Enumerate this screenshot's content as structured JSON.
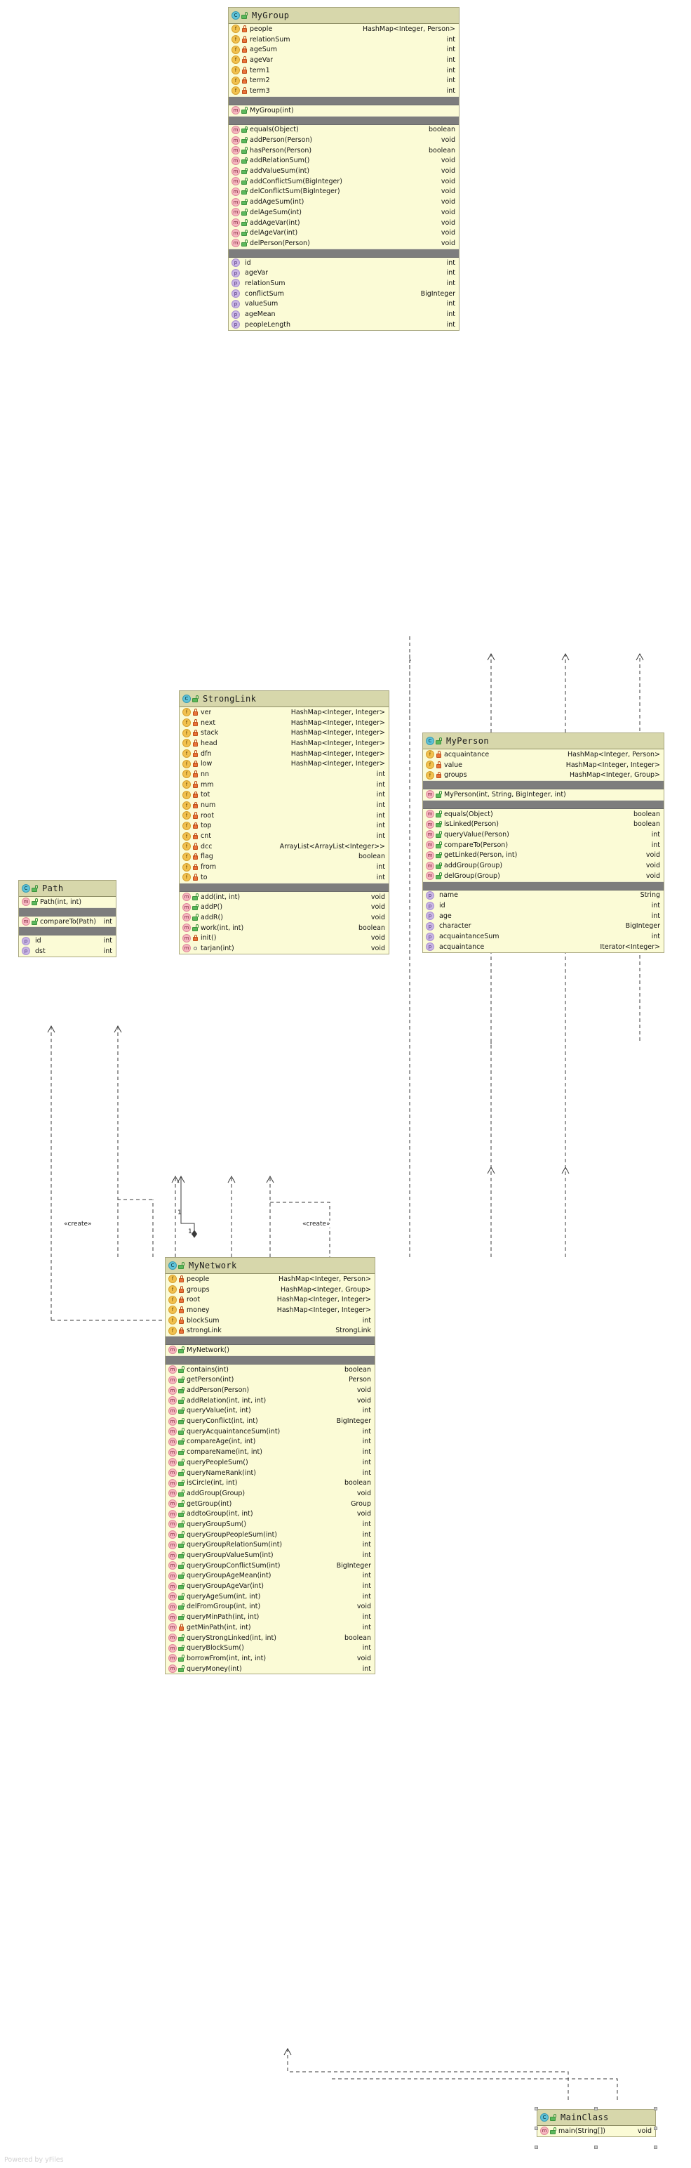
{
  "diagram": {
    "watermark": "Powered by yFiles",
    "edge_labels": [
      "«create»",
      "«create»"
    ],
    "multiplicity_labels": [
      "1",
      "1"
    ],
    "colors": {
      "class_body": "#fbfbd6",
      "class_header": "#d7d7ab",
      "class_border": "#a9a780",
      "separator": "#7d7d7d",
      "field_icon": "#f2c14e",
      "method_icon": "#f6b7c0",
      "property_icon": "#c9b6e4",
      "class_icon": "#5fc2d8",
      "private_lock": "#e8743b",
      "public_lock": "#5cb85c"
    }
  },
  "classes": {
    "mygroup": {
      "name": "MyGroup",
      "fields": [
        {
          "name": "people",
          "type": "HashMap<Integer, Person>",
          "vis": "private",
          "inline": true
        },
        {
          "name": "relationSum",
          "type": "int",
          "vis": "private"
        },
        {
          "name": "ageSum",
          "type": "int",
          "vis": "private"
        },
        {
          "name": "ageVar",
          "type": "int",
          "vis": "private"
        },
        {
          "name": "term1",
          "type": "int",
          "vis": "private"
        },
        {
          "name": "term2",
          "type": "int",
          "vis": "private"
        },
        {
          "name": "term3",
          "type": "int",
          "vis": "private"
        }
      ],
      "constructors": [
        {
          "name": "MyGroup(int)",
          "type": "",
          "vis": "public"
        }
      ],
      "methods": [
        {
          "name": "equals(Object)",
          "type": "boolean",
          "vis": "public"
        },
        {
          "name": "addPerson(Person)",
          "type": "void",
          "vis": "public"
        },
        {
          "name": "hasPerson(Person)",
          "type": "boolean",
          "vis": "public"
        },
        {
          "name": "addRelationSum()",
          "type": "void",
          "vis": "public"
        },
        {
          "name": "addValueSum(int)",
          "type": "void",
          "vis": "public"
        },
        {
          "name": "addConflictSum(BigInteger)",
          "type": "void",
          "vis": "public"
        },
        {
          "name": "delConflictSum(BigInteger)",
          "type": "void",
          "vis": "public"
        },
        {
          "name": "addAgeSum(int)",
          "type": "void",
          "vis": "public"
        },
        {
          "name": "delAgeSum(int)",
          "type": "void",
          "vis": "public"
        },
        {
          "name": "addAgeVar(int)",
          "type": "void",
          "vis": "public"
        },
        {
          "name": "delAgeVar(int)",
          "type": "void",
          "vis": "public"
        },
        {
          "name": "delPerson(Person)",
          "type": "void",
          "vis": "public"
        }
      ],
      "properties": [
        {
          "name": "id",
          "type": "int"
        },
        {
          "name": "ageVar",
          "type": "int"
        },
        {
          "name": "relationSum",
          "type": "int"
        },
        {
          "name": "conflictSum",
          "type": "BigInteger"
        },
        {
          "name": "valueSum",
          "type": "int"
        },
        {
          "name": "ageMean",
          "type": "int"
        },
        {
          "name": "peopleLength",
          "type": "int"
        }
      ]
    },
    "stronglink": {
      "name": "StrongLink",
      "fields": [
        {
          "name": "ver",
          "type": "HashMap<Integer, Integer>",
          "vis": "private"
        },
        {
          "name": "next",
          "type": "HashMap<Integer, Integer>",
          "vis": "private"
        },
        {
          "name": "stack",
          "type": "HashMap<Integer, Integer>",
          "vis": "private"
        },
        {
          "name": "head",
          "type": "HashMap<Integer, Integer>",
          "vis": "private"
        },
        {
          "name": "dfn",
          "type": "HashMap<Integer, Integer>",
          "vis": "private"
        },
        {
          "name": "low",
          "type": "HashMap<Integer, Integer>",
          "vis": "private"
        },
        {
          "name": "nn",
          "type": "int",
          "vis": "private"
        },
        {
          "name": "mm",
          "type": "int",
          "vis": "private"
        },
        {
          "name": "tot",
          "type": "int",
          "vis": "private"
        },
        {
          "name": "num",
          "type": "int",
          "vis": "private"
        },
        {
          "name": "root",
          "type": "int",
          "vis": "private"
        },
        {
          "name": "top",
          "type": "int",
          "vis": "private"
        },
        {
          "name": "cnt",
          "type": "int",
          "vis": "private"
        },
        {
          "name": "dcc",
          "type": "ArrayList<ArrayList<Integer>>",
          "vis": "private",
          "inline": true
        },
        {
          "name": "flag",
          "type": "boolean",
          "vis": "private"
        },
        {
          "name": "from",
          "type": "int",
          "vis": "private"
        },
        {
          "name": "to",
          "type": "int",
          "vis": "private"
        }
      ],
      "constructors": [],
      "methods": [
        {
          "name": "add(int, int)",
          "type": "void",
          "vis": "public"
        },
        {
          "name": "addP()",
          "type": "void",
          "vis": "public"
        },
        {
          "name": "addR()",
          "type": "void",
          "vis": "public"
        },
        {
          "name": "work(int, int)",
          "type": "boolean",
          "vis": "public"
        },
        {
          "name": "init()",
          "type": "void",
          "vis": "private"
        },
        {
          "name": "tarjan(int)",
          "type": "void",
          "vis": "package"
        }
      ],
      "properties": []
    },
    "path": {
      "name": "Path",
      "fields": [],
      "constructors": [
        {
          "name": "Path(int, int)",
          "type": "",
          "vis": "public"
        }
      ],
      "methods": [
        {
          "name": "compareTo(Path)",
          "type": "int",
          "vis": "public",
          "inline": true
        }
      ],
      "properties": [
        {
          "name": "id",
          "type": "int"
        },
        {
          "name": "dst",
          "type": "int"
        }
      ]
    },
    "myperson": {
      "name": "MyPerson",
      "fields": [
        {
          "name": "acquaintance",
          "type": "HashMap<Integer, Person>",
          "vis": "private",
          "inline": true
        },
        {
          "name": "value",
          "type": "HashMap<Integer, Integer>",
          "vis": "private"
        },
        {
          "name": "groups",
          "type": "HashMap<Integer, Group>",
          "vis": "private"
        }
      ],
      "constructors": [
        {
          "name": "MyPerson(int, String, BigInteger, int)",
          "type": "",
          "vis": "public"
        }
      ],
      "methods": [
        {
          "name": "equals(Object)",
          "type": "boolean",
          "vis": "public"
        },
        {
          "name": "isLinked(Person)",
          "type": "boolean",
          "vis": "public"
        },
        {
          "name": "queryValue(Person)",
          "type": "int",
          "vis": "public"
        },
        {
          "name": "compareTo(Person)",
          "type": "int",
          "vis": "public"
        },
        {
          "name": "getLinked(Person, int)",
          "type": "void",
          "vis": "public"
        },
        {
          "name": "addGroup(Group)",
          "type": "void",
          "vis": "public"
        },
        {
          "name": "delGroup(Group)",
          "type": "void",
          "vis": "public"
        }
      ],
      "properties": [
        {
          "name": "name",
          "type": "String"
        },
        {
          "name": "id",
          "type": "int"
        },
        {
          "name": "age",
          "type": "int"
        },
        {
          "name": "character",
          "type": "BigInteger"
        },
        {
          "name": "acquaintanceSum",
          "type": "int"
        },
        {
          "name": "acquaintance",
          "type": "Iterator<Integer>"
        }
      ]
    },
    "mynetwork": {
      "name": "MyNetwork",
      "fields": [
        {
          "name": "people",
          "type": "HashMap<Integer, Person>",
          "vis": "private"
        },
        {
          "name": "groups",
          "type": "HashMap<Integer, Group>",
          "vis": "private"
        },
        {
          "name": "root",
          "type": "HashMap<Integer, Integer>",
          "vis": "private"
        },
        {
          "name": "money",
          "type": "HashMap<Integer, Integer>",
          "vis": "private"
        },
        {
          "name": "blockSum",
          "type": "int",
          "vis": "private"
        },
        {
          "name": "strongLink",
          "type": "StrongLink",
          "vis": "private"
        }
      ],
      "constructors": [
        {
          "name": "MyNetwork()",
          "type": "",
          "vis": "public"
        }
      ],
      "methods": [
        {
          "name": "contains(int)",
          "type": "boolean",
          "vis": "public"
        },
        {
          "name": "getPerson(int)",
          "type": "Person",
          "vis": "public"
        },
        {
          "name": "addPerson(Person)",
          "type": "void",
          "vis": "public"
        },
        {
          "name": "addRelation(int, int, int)",
          "type": "void",
          "vis": "public"
        },
        {
          "name": "queryValue(int, int)",
          "type": "int",
          "vis": "public"
        },
        {
          "name": "queryConflict(int, int)",
          "type": "BigInteger",
          "vis": "public"
        },
        {
          "name": "queryAcquaintanceSum(int)",
          "type": "int",
          "vis": "public"
        },
        {
          "name": "compareAge(int, int)",
          "type": "int",
          "vis": "public"
        },
        {
          "name": "compareName(int, int)",
          "type": "int",
          "vis": "public"
        },
        {
          "name": "queryPeopleSum()",
          "type": "int",
          "vis": "public"
        },
        {
          "name": "queryNameRank(int)",
          "type": "int",
          "vis": "public"
        },
        {
          "name": "isCircle(int, int)",
          "type": "boolean",
          "vis": "public"
        },
        {
          "name": "addGroup(Group)",
          "type": "void",
          "vis": "public"
        },
        {
          "name": "getGroup(int)",
          "type": "Group",
          "vis": "public"
        },
        {
          "name": "addtoGroup(int, int)",
          "type": "void",
          "vis": "public"
        },
        {
          "name": "queryGroupSum()",
          "type": "int",
          "vis": "public"
        },
        {
          "name": "queryGroupPeopleSum(int)",
          "type": "int",
          "vis": "public"
        },
        {
          "name": "queryGroupRelationSum(int)",
          "type": "int",
          "vis": "public"
        },
        {
          "name": "queryGroupValueSum(int)",
          "type": "int",
          "vis": "public"
        },
        {
          "name": "queryGroupConflictSum(int)",
          "type": "BigInteger",
          "vis": "public",
          "inline": true
        },
        {
          "name": "queryGroupAgeMean(int)",
          "type": "int",
          "vis": "public"
        },
        {
          "name": "queryGroupAgeVar(int)",
          "type": "int",
          "vis": "public"
        },
        {
          "name": "queryAgeSum(int, int)",
          "type": "int",
          "vis": "public"
        },
        {
          "name": "delFromGroup(int, int)",
          "type": "void",
          "vis": "public"
        },
        {
          "name": "queryMinPath(int, int)",
          "type": "int",
          "vis": "public"
        },
        {
          "name": "getMinPath(int, int)",
          "type": "int",
          "vis": "private"
        },
        {
          "name": "queryStrongLinked(int, int)",
          "type": "boolean",
          "vis": "public"
        },
        {
          "name": "queryBlockSum()",
          "type": "int",
          "vis": "public"
        },
        {
          "name": "borrowFrom(int, int, int)",
          "type": "void",
          "vis": "public"
        },
        {
          "name": "queryMoney(int)",
          "type": "int",
          "vis": "public"
        }
      ],
      "properties": []
    },
    "mainclass": {
      "name": "MainClass",
      "fields": [],
      "constructors": [],
      "methods": [
        {
          "name": "main(String[])",
          "type": "void",
          "vis": "public",
          "inline": true
        }
      ],
      "properties": []
    }
  }
}
